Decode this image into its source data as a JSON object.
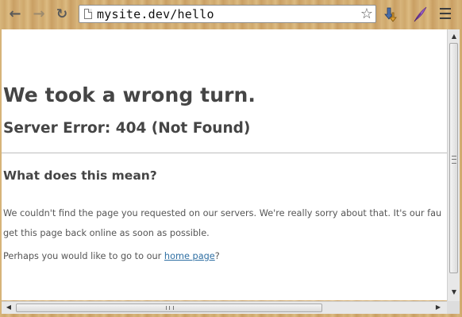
{
  "browser": {
    "url": "mysite.dev/hello",
    "back_icon": "back-arrow-icon",
    "forward_icon": "forward-arrow-icon",
    "reload_icon": "reload-icon",
    "bookmark_icon": "star-icon",
    "extensions": [
      "download-arrow-extension-icon",
      "feather-quill-extension-icon"
    ],
    "menu_icon": "hamburger-menu-icon"
  },
  "page": {
    "heading": "We took a wrong turn.",
    "error_line": "Server Error: 404 (Not Found)",
    "section_title": "What does this mean?",
    "paragraph_line1": "We couldn't find the page you requested on our servers. We're really sorry about that. It's our fau",
    "paragraph_line2": "get this page back online as soon as possible.",
    "prompt_before_link": "Perhaps you would like to go to our ",
    "link_text": "home page",
    "prompt_after_link": "?"
  },
  "colors": {
    "heading": "#454545",
    "body_text": "#555555",
    "link": "#2f6fa3",
    "frame": "#d8b67c"
  }
}
